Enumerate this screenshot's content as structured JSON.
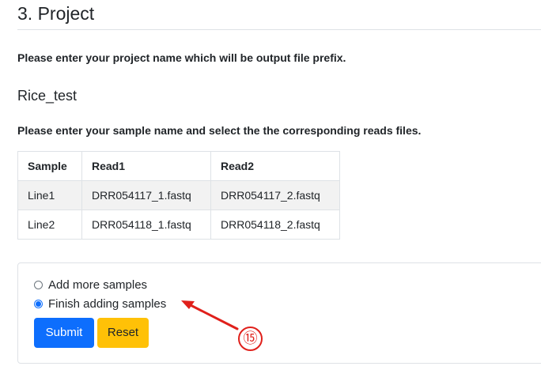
{
  "section": {
    "title": "3. Project"
  },
  "project": {
    "prompt": "Please enter your project name which will be output file prefix.",
    "name": "Rice_test"
  },
  "samples": {
    "prompt": "Please enter your sample name and select the the corresponding reads files.",
    "columns": [
      "Sample",
      "Read1",
      "Read2"
    ],
    "rows": [
      [
        "Line1",
        "DRR054117_1.fastq",
        "DRR054117_2.fastq"
      ],
      [
        "Line2",
        "DRR054118_1.fastq",
        "DRR054118_2.fastq"
      ]
    ]
  },
  "form": {
    "options": [
      {
        "label": "Add more samples",
        "checked": false
      },
      {
        "label": "Finish adding samples",
        "checked": true
      }
    ],
    "submit_label": "Submit",
    "reset_label": "Reset"
  },
  "annotation": {
    "marker": "⑮",
    "color": "#e0201b"
  },
  "colors": {
    "primary": "#0d6efd",
    "warning": "#ffc107",
    "border": "#dee2e6",
    "stripe": "#f2f2f2"
  }
}
